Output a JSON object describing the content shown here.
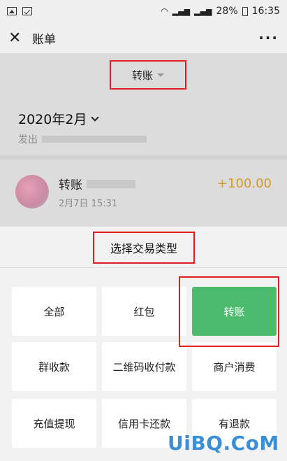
{
  "status_bar": {
    "battery": "28%",
    "time": "16:35"
  },
  "header": {
    "title": "账单"
  },
  "filter": {
    "label": "转账"
  },
  "month": {
    "label": "2020年2月"
  },
  "sent": {
    "label": "发出"
  },
  "transaction": {
    "name": "转账",
    "time": "2月7日 15:31",
    "amount": "+100.00"
  },
  "sheet": {
    "title": "选择交易类型",
    "options": [
      "全部",
      "红包",
      "转账",
      "群收款",
      "二维码收付款",
      "商户消费",
      "充值提现",
      "信用卡还款",
      "有退款"
    ],
    "selected": "转账"
  },
  "colors": {
    "accent_green": "#4dbb6d",
    "amount": "#d39a2c",
    "highlight_red": "#e02020"
  },
  "watermark": "UiBQ.CoM"
}
